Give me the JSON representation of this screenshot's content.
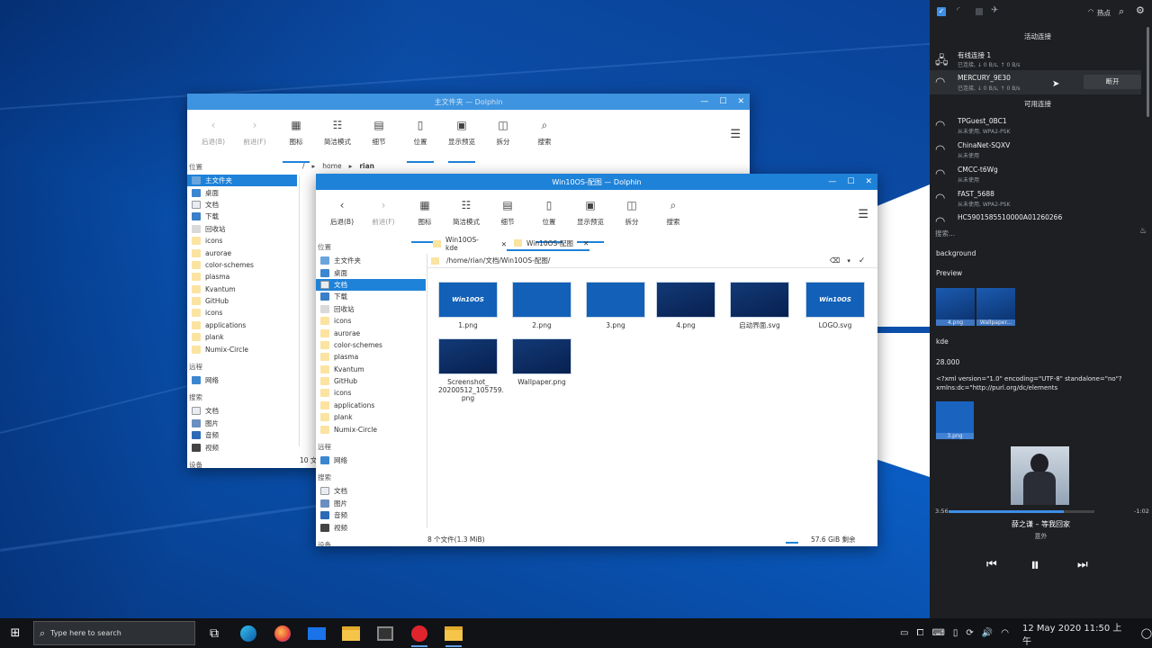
{
  "back_window": {
    "title": "主文件夹 — Dolphin",
    "toolbar": [
      "后退(B)",
      "前进(F)",
      "图标",
      "简洁模式",
      "细节",
      "位置",
      "显示预览",
      "拆分",
      "搜索"
    ],
    "breadcrumb": [
      "home",
      "rian"
    ],
    "sidebar_section_places": "位置",
    "places": [
      "主文件夹",
      "桌面",
      "文档",
      "下载",
      "回收站",
      "icons",
      "aurorae",
      "color-schemes",
      "plasma",
      "Kvantum",
      "GitHub",
      "icons",
      "applications",
      "plank",
      "Numix-Circle"
    ],
    "sidebar_section_remote": "远程",
    "remote": [
      "网络"
    ],
    "sidebar_section_search": "搜索",
    "search": [
      "文档",
      "图片",
      "音频",
      "视频"
    ],
    "sidebar_section_devices": "设备",
    "status_partial": "10 文"
  },
  "front_window": {
    "title": "Win10OS-配图 — Dolphin",
    "toolbar": [
      "后退(B)",
      "前进(F)",
      "图标",
      "简洁模式",
      "细节",
      "位置",
      "显示预览",
      "拆分",
      "搜索"
    ],
    "tabs": [
      "Win10OS-kde",
      "Win10OS-配图"
    ],
    "path": "/home/rian/文档/Win10OS-配图/",
    "sidebar_section_places": "位置",
    "places": [
      "主文件夹",
      "桌面",
      "文档",
      "下载",
      "回收站",
      "icons",
      "aurorae",
      "color-schemes",
      "plasma",
      "Kvantum",
      "GitHub",
      "icons",
      "applications",
      "plank",
      "Numix-Circle"
    ],
    "sidebar_section_remote": "远程",
    "remote": [
      "网络"
    ],
    "sidebar_section_search": "搜索",
    "search": [
      "文档",
      "图片",
      "音频",
      "视频"
    ],
    "sidebar_section_devices": "设备",
    "files": [
      {
        "name": "1.png",
        "thumb_text": "Win10OS"
      },
      {
        "name": "2.png",
        "thumb_text": ""
      },
      {
        "name": "3.png",
        "thumb_text": ""
      },
      {
        "name": "4.png",
        "thumb_text": ""
      },
      {
        "name": "启动界面.svg",
        "thumb_text": ""
      },
      {
        "name": "LOGO.svg",
        "thumb_text": "Win10OS"
      },
      {
        "name": "Screenshot_\n20200512_105759.\npng",
        "thumb_text": ""
      },
      {
        "name": "Wallpaper.png",
        "thumb_text": ""
      }
    ],
    "status_left": "8 个文件(1.3 MiB)",
    "status_right": "57.6 GiB 剩余"
  },
  "panel": {
    "hotspot": "热点",
    "active_header": "活动连接",
    "active": [
      {
        "name": "有线连接 1",
        "sub": "已连接, ↓ 0 B/s, ↑ 0 B/s"
      },
      {
        "name": "MERCURY_9E30",
        "sub": "已连接, ↓ 0 B/s, ↑ 0 B/s",
        "button": "断开"
      }
    ],
    "available_header": "可用连接",
    "available": [
      {
        "name": "TPGuest_0BC1",
        "sub": "从未使用, WPA2-PSK"
      },
      {
        "name": "ChinaNet-SQXV",
        "sub": "从未使用"
      },
      {
        "name": "CMCC-t6Wg",
        "sub": "从未使用"
      },
      {
        "name": "FAST_5688",
        "sub": "从未使用, WPA2-PSK"
      },
      {
        "name": "HC5901585510000A01260266",
        "sub": ""
      }
    ],
    "search_placeholder": "搜索...",
    "clip1": "background",
    "clip2": "Preview",
    "clip_thumbs": [
      "4.png",
      "Wallpaper..."
    ],
    "clip3": "kde",
    "clip4": "28.000",
    "clip5_line1": "<?xml version=\"1.0\" encoding=\"UTF-8\" standalone=\"no\"?",
    "clip5_line2": "xmlns:dc=\"http://purl.org/dc/elements",
    "clip_thumb2": "3.png",
    "media": {
      "elapsed": "3:56",
      "remaining": "-1:02",
      "progress": 0.79,
      "title": "薛之谦 – 等我回家",
      "album": "意外"
    }
  },
  "taskbar": {
    "search_placeholder": "Type here to search",
    "clock": "12 May 2020 11:50 上午"
  }
}
